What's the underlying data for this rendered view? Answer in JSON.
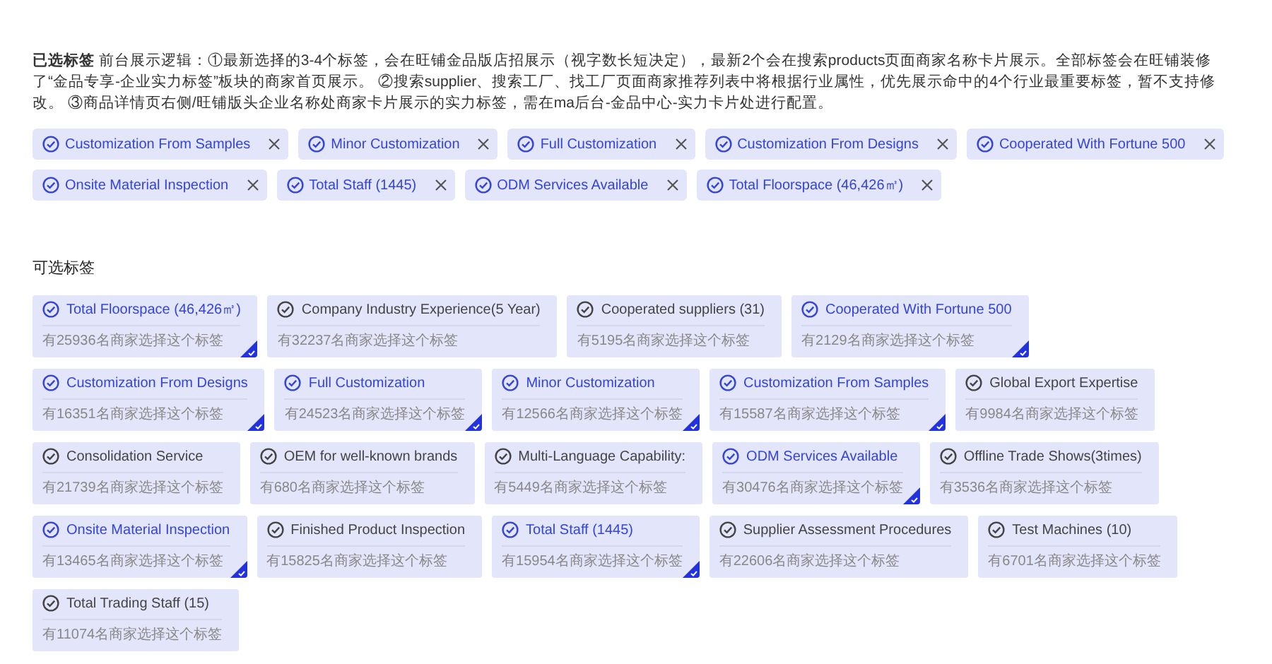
{
  "selected_section": {
    "description": "**已选标签** 前台展示逻辑：①最新选择的3-4个标签，会在旺铺金品版店招展示（视字数长短决定），最新2个会在搜索products页面商家名称卡片展示。全部标签会在旺铺装修了“金品专享-企业实力标签”板块的商家首页展示。 ②搜索supplier、搜索工厂、找工厂页面商家推荐列表中将根据行业属性，优先展示命中的4个行业最重要标签，暂不支持修改。 ③商品详情页右侧/旺铺版头企业名称处商家卡片展示的实力标签，需在ma后台-金品中心-实力卡片处进行配置。",
    "tags": [
      {
        "label": "Customization From Samples"
      },
      {
        "label": "Minor Customization"
      },
      {
        "label": "Full Customization"
      },
      {
        "label": "Customization From Designs"
      },
      {
        "label": "Cooperated With Fortune 500"
      },
      {
        "label": "Onsite Material Inspection"
      },
      {
        "label": "Total Staff (1445)"
      },
      {
        "label": "ODM Services Available"
      },
      {
        "label": "Total Floorspace (46,426㎡)"
      }
    ]
  },
  "available_section": {
    "title": "可选标签",
    "cards": [
      {
        "label": "Total Floorspace (46,426㎡)",
        "count": "有25936名商家选择这个标签",
        "selected": true
      },
      {
        "label": "Company Industry Experience(5 Year)",
        "count": "有32237名商家选择这个标签",
        "selected": false
      },
      {
        "label": "Cooperated suppliers (31)",
        "count": "有5195名商家选择这个标签",
        "selected": false
      },
      {
        "label": "Cooperated With Fortune 500",
        "count": "有2129名商家选择这个标签",
        "selected": true
      },
      {
        "label": "Customization From Designs",
        "count": "有16351名商家选择这个标签",
        "selected": true
      },
      {
        "label": "Full Customization",
        "count": "有24523名商家选择这个标签",
        "selected": true
      },
      {
        "label": "Minor Customization",
        "count": "有12566名商家选择这个标签",
        "selected": true
      },
      {
        "label": "Customization From Samples",
        "count": "有15587名商家选择这个标签",
        "selected": true
      },
      {
        "label": "Global Export Expertise",
        "count": "有9984名商家选择这个标签",
        "selected": false
      },
      {
        "label": "Consolidation Service",
        "count": "有21739名商家选择这个标签",
        "selected": false
      },
      {
        "label": "OEM for well-known brands",
        "count": "有680名商家选择这个标签",
        "selected": false
      },
      {
        "label": "Multi-Language Capability:",
        "count": "有5449名商家选择这个标签",
        "selected": false
      },
      {
        "label": "ODM Services Available",
        "count": "有30476名商家选择这个标签",
        "selected": true
      },
      {
        "label": "Offline Trade Shows(3times)",
        "count": "有3536名商家选择这个标签",
        "selected": false
      },
      {
        "label": "Onsite Material Inspection",
        "count": "有13465名商家选择这个标签",
        "selected": true
      },
      {
        "label": "Finished Product Inspection",
        "count": "有15825名商家选择这个标签",
        "selected": false
      },
      {
        "label": "Total Staff (1445)",
        "count": "有15954名商家选择这个标签",
        "selected": true
      },
      {
        "label": "Supplier Assessment Procedures",
        "count": "有22606名商家选择这个标签",
        "selected": false
      },
      {
        "label": "Test Machines (10)",
        "count": "有6701名商家选择这个标签",
        "selected": false
      },
      {
        "label": "Total Trading Staff (15)",
        "count": "有11074名商家选择这个标签",
        "selected": false
      }
    ]
  }
}
